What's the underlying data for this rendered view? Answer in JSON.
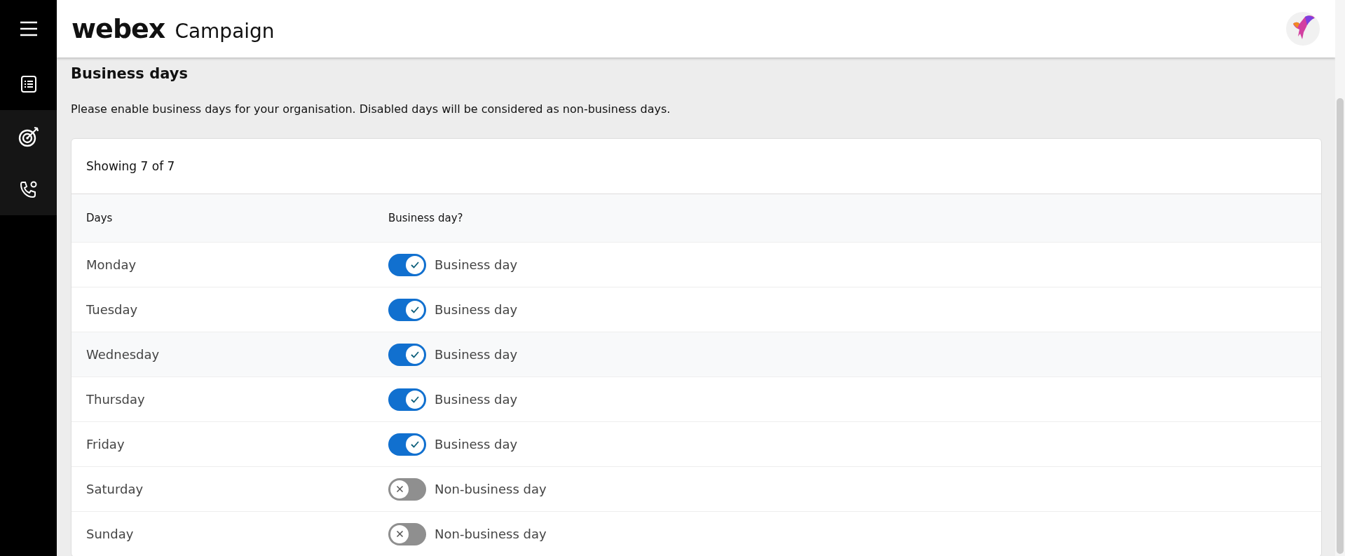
{
  "header": {
    "brand": "webex",
    "product": "Campaign"
  },
  "sidebar": {
    "items": [
      {
        "kind": "list"
      },
      {
        "kind": "target"
      },
      {
        "kind": "phone"
      }
    ]
  },
  "page": {
    "title": "Business days",
    "description": "Please enable business days for your organisation. Disabled days will be considered as non-business days."
  },
  "table": {
    "summary": "Showing 7 of 7",
    "columns": [
      "Days",
      "Business day?"
    ],
    "rows": [
      {
        "day": "Monday",
        "on": true,
        "label": "Business day"
      },
      {
        "day": "Tuesday",
        "on": true,
        "label": "Business day"
      },
      {
        "day": "Wednesday",
        "on": true,
        "label": "Business day"
      },
      {
        "day": "Thursday",
        "on": true,
        "label": "Business day"
      },
      {
        "day": "Friday",
        "on": true,
        "label": "Business day"
      },
      {
        "day": "Saturday",
        "on": false,
        "label": "Non-business day"
      },
      {
        "day": "Sunday",
        "on": false,
        "label": "Non-business day"
      }
    ]
  }
}
